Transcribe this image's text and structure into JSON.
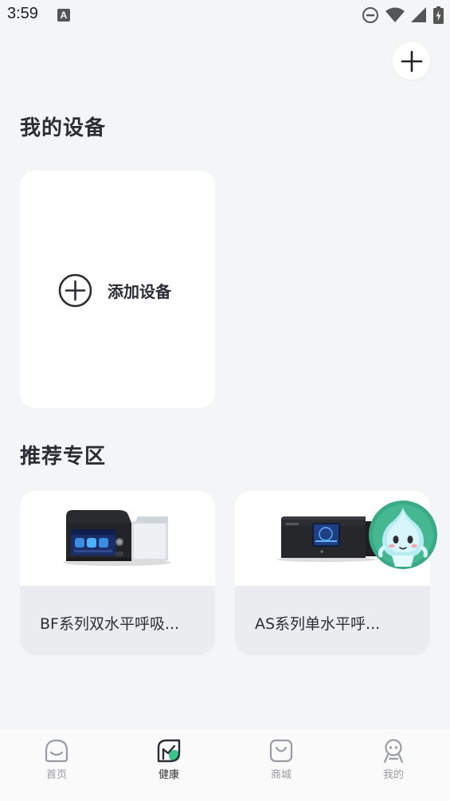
{
  "status_bar": {
    "time": "3:59",
    "notification_icon_letter": "A",
    "icons": [
      "dnd-icon",
      "wifi-icon",
      "signal-icon",
      "battery-icon"
    ]
  },
  "header": {
    "add_button_icon": "plus-icon"
  },
  "my_devices": {
    "title": "我的设备",
    "add_device_label": "添加设备"
  },
  "recommended": {
    "title": "推荐专区",
    "products": [
      {
        "name": "BF系列双水平呼吸..."
      },
      {
        "name": "AS系列单水平呼..."
      }
    ]
  },
  "bottom_nav": {
    "items": [
      {
        "label": "首页",
        "icon": "home-icon",
        "active": false
      },
      {
        "label": "健康",
        "icon": "health-icon",
        "active": true
      },
      {
        "label": "商城",
        "icon": "shop-icon",
        "active": false
      },
      {
        "label": "我的",
        "icon": "profile-icon",
        "active": false
      }
    ]
  },
  "colors": {
    "background": "#f4f5f7",
    "card": "#ffffff",
    "accent_green": "#3cc48a",
    "text_primary": "#2b2d33",
    "text_secondary": "#9a9ca3"
  }
}
